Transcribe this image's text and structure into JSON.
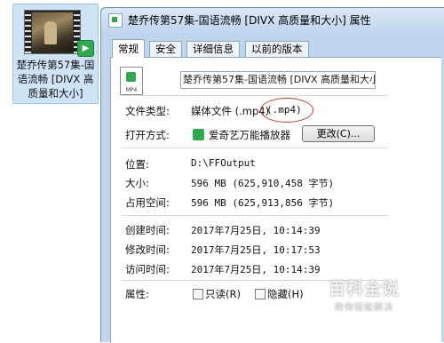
{
  "desktop_file": {
    "name": "楚乔传第57集-国语流畅 [DIVX 高质量和大小]",
    "badge_icon": "play-badge-icon"
  },
  "window": {
    "title": "楚乔传第57集-国语流畅 [DIVX 高质量和大小] 属性"
  },
  "tabs": [
    {
      "label": "常规",
      "active": true
    },
    {
      "label": "安全"
    },
    {
      "label": "详细信息"
    },
    {
      "label": "以前的版本"
    }
  ],
  "general": {
    "file_icon_ext": "MP4",
    "file_name": "楚乔传第57集-国语流畅 [DIVX 高质量和大小]",
    "type_label": "文件类型:",
    "type_value": "媒体文件 (.mp4)",
    "type_ext_highlight": "(.mp4)",
    "open_with_label": "打开方式:",
    "open_with_value": "爱奇艺万能播放器",
    "change_button": "更改(C)...",
    "location_label": "位置:",
    "location_value": "D:\\FFOutput",
    "size_label": "大小:",
    "size_value": "596 MB (625,910,458 字节)",
    "disk_size_label": "占用空间:",
    "disk_size_value": "596 MB (625,913,856 字节)",
    "created_label": "创建时间:",
    "created_value": "2017年7月25日, 10:14:39",
    "modified_label": "修改时间:",
    "modified_value": "2017年7月25日, 10:17:53",
    "accessed_label": "访问时间:",
    "accessed_value": "2017年7月25日, 10:14:39",
    "attributes_label": "属性:",
    "readonly_label": "只读(R)",
    "hidden_label": "隐藏(H)"
  },
  "watermark": {
    "title": "百科全说",
    "subtitle": "助你轻松解决"
  },
  "colors": {
    "accent_green": "#2fa84f",
    "highlight_red": "#c0392b"
  }
}
